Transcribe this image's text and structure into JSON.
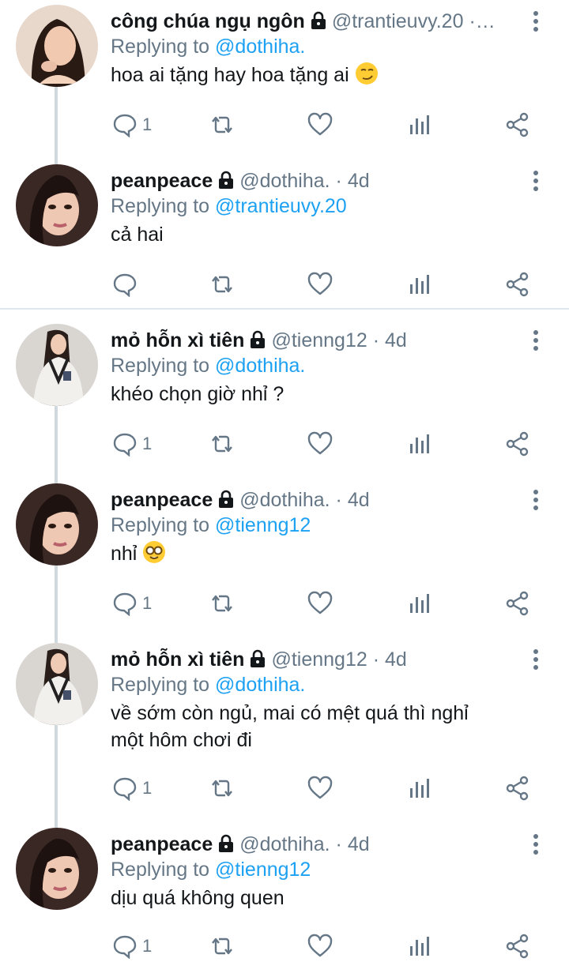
{
  "tweets": [
    {
      "name": "công chúa ngụ ngôn",
      "handle": "@trantieuvy.20",
      "dot": "·…",
      "time": "",
      "replying_prefix": "Replying to ",
      "replying_to": "@dothiha.",
      "text": "hoa ai tặng hay hoa tặng ai",
      "emoji": "smirk-face",
      "reply_count": "1"
    },
    {
      "name": "peanpeace",
      "handle": "@dothiha.",
      "dot": "·",
      "time": "4d",
      "replying_prefix": "Replying to ",
      "replying_to": "@trantieuvy.20",
      "text": "cả hai",
      "reply_count": ""
    },
    {
      "name": "mỏ hỗn xì tiên",
      "handle": "@tienng12",
      "dot": "·",
      "time": "4d",
      "replying_prefix": "Replying to ",
      "replying_to": "@dothiha.",
      "text": "khéo chọn giờ nhỉ ?",
      "reply_count": "1"
    },
    {
      "name": "peanpeace",
      "handle": "@dothiha.",
      "dot": "·",
      "time": "4d",
      "replying_prefix": "Replying to ",
      "replying_to": "@tienng12",
      "text": "nhỉ",
      "emoji": "nerd-face",
      "reply_count": "1"
    },
    {
      "name": "mỏ hỗn xì tiên",
      "handle": "@tienng12",
      "dot": "·",
      "time": "4d",
      "replying_prefix": "Replying to ",
      "replying_to": "@dothiha.",
      "text_line1": "về sớm còn ngủ, mai có mệt quá thì nghỉ",
      "text_line2": "một hôm chơi đi",
      "reply_count": "1"
    },
    {
      "name": "peanpeace",
      "handle": "@dothiha.",
      "dot": "·",
      "time": "4d",
      "replying_prefix": "Replying to ",
      "replying_to": "@tienng12",
      "text": "dịu quá không quen",
      "reply_count": "1"
    }
  ],
  "colors": {
    "accent": "#1da1f2",
    "secondary_text": "#657786",
    "icon": "#657786",
    "thread_line": "#cfd9de"
  }
}
